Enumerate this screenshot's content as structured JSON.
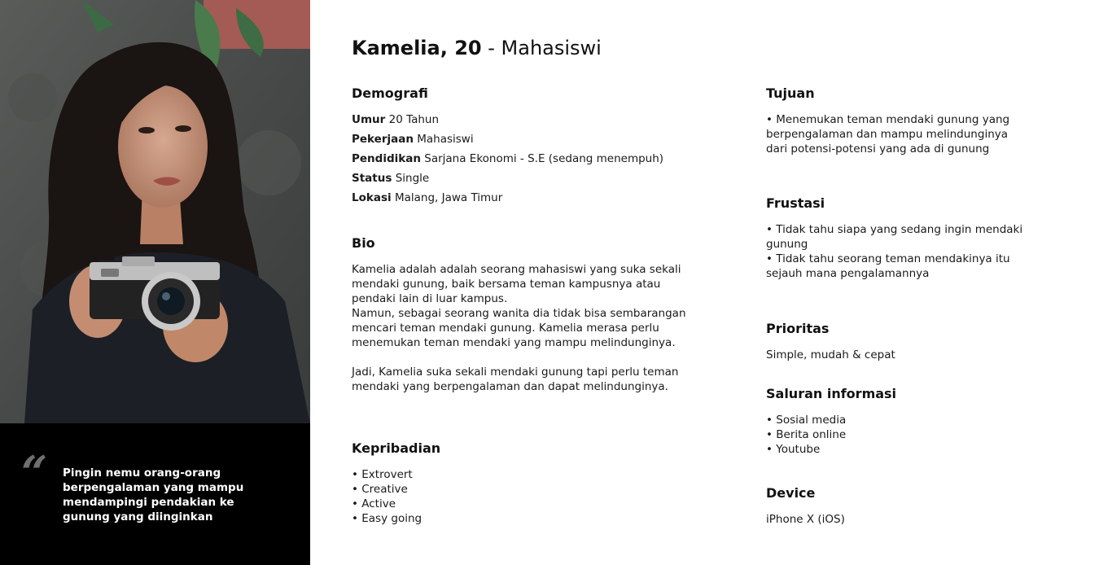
{
  "title": {
    "name": "Kamelia, 20",
    "separator": " - ",
    "role": "Mahasiswi"
  },
  "quote": {
    "mark": "“",
    "lines": [
      "Pingin nemu orang-orang",
      "berpengalaman yang mampu",
      "mendampingi pendakian ke",
      "gunung yang diinginkan"
    ]
  },
  "demografi": {
    "heading": "Demografi",
    "rows": [
      {
        "label": "Umur",
        "value": "20 Tahun"
      },
      {
        "label": "Pekerjaan",
        "value": "Mahasiswi"
      },
      {
        "label": "Pendidikan",
        "value": "Sarjana Ekonomi - S.E (sedang menempuh)"
      },
      {
        "label": "Status",
        "value": "Single"
      },
      {
        "label": "Lokasi",
        "value": "Malang, Jawa Timur"
      }
    ]
  },
  "bio": {
    "heading": "Bio",
    "lines": [
      "Kamelia adalah adalah seorang mahasiswi yang suka sekali",
      "mendaki gunung, baik bersama teman kampusnya atau",
      "pendaki lain di luar kampus.",
      "Namun, sebagai seorang wanita dia tidak bisa sembarangan",
      "mencari teman mendaki gunung. Kamelia merasa perlu",
      "menemukan teman mendaki yang mampu melindunginya.",
      "",
      "Jadi, Kamelia suka sekali mendaki gunung tapi perlu teman",
      "mendaki yang berpengalaman dan dapat melindunginya."
    ]
  },
  "kepribadian": {
    "heading": "Kepribadian",
    "items": [
      "• Extrovert",
      "• Creative",
      "• Active",
      "• Easy going"
    ]
  },
  "tujuan": {
    "heading": "Tujuan",
    "lines": [
      "• Menemukan teman mendaki gunung yang",
      "berpengalaman dan mampu melindunginya",
      "dari potensi-potensi yang ada di gunung"
    ]
  },
  "frustasi": {
    "heading": "Frustasi",
    "lines": [
      "• Tidak tahu siapa yang sedang ingin mendaki",
      "gunung",
      "• Tidak tahu seorang teman mendakinya itu",
      "sejauh mana pengalamannya"
    ]
  },
  "prioritas": {
    "heading": "Prioritas",
    "text": "Simple, mudah & cepat"
  },
  "saluran": {
    "heading": "Saluran informasi",
    "items": [
      "• Sosial media",
      "• Berita online",
      "• Youtube"
    ]
  },
  "device": {
    "heading": "Device",
    "text": "iPhone X (iOS)"
  }
}
